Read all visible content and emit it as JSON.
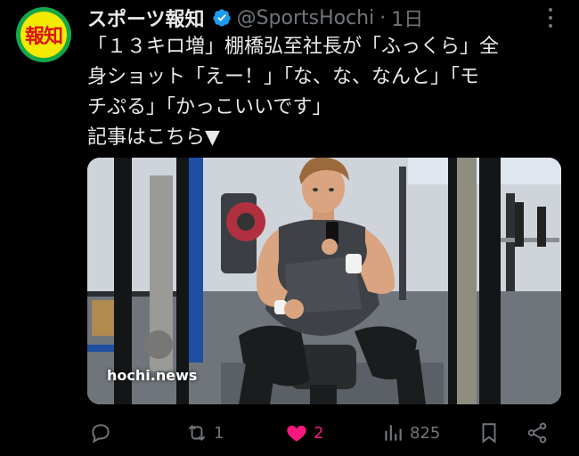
{
  "avatar": {
    "text": "報知"
  },
  "header": {
    "name": "スポーツ報知",
    "handle": "@SportsHochi",
    "separator": "·",
    "time": "1日"
  },
  "tweet": {
    "lines": [
      "「１３キロ増」棚橋弘至社長が「ふっくら」全",
      "身ショット「えー！」「な、な、なんと」「モ",
      "チぷる」「かっこいいです」",
      "記事はこちら▼"
    ]
  },
  "media": {
    "watermark": "hochi.news"
  },
  "actions": {
    "reply_count": "",
    "retweet_count": "1",
    "like_count": "2",
    "views_count": "825"
  },
  "colors": {
    "background": "#000000",
    "text": "#e7e9ea",
    "muted": "#71767b",
    "verified": "#1d9bf0",
    "like": "#f91880"
  }
}
